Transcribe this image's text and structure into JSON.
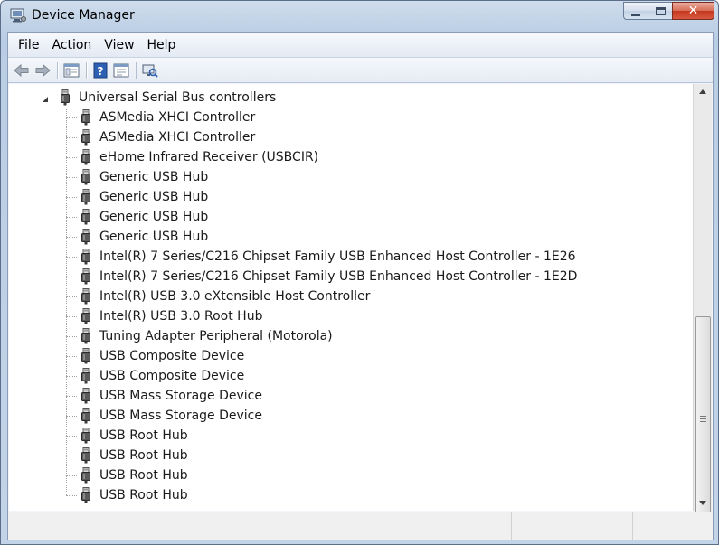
{
  "window": {
    "title": "Device Manager"
  },
  "menu": {
    "items": [
      "File",
      "Action",
      "View",
      "Help"
    ]
  },
  "toolbar": {
    "buttons": [
      "back-icon",
      "forward-icon",
      "tree-view-icon",
      "help-icon",
      "properties-icon",
      "scan-hardware-icon"
    ]
  },
  "tree": {
    "category": {
      "label": "Universal Serial Bus controllers",
      "expanded": true
    },
    "devices": [
      "ASMedia XHCI Controller",
      "ASMedia XHCI Controller",
      "eHome Infrared Receiver (USBCIR)",
      "Generic USB Hub",
      "Generic USB Hub",
      "Generic USB Hub",
      "Generic USB Hub",
      "Intel(R) 7 Series/C216 Chipset Family USB Enhanced Host Controller - 1E26",
      "Intel(R) 7 Series/C216 Chipset Family USB Enhanced Host Controller - 1E2D",
      "Intel(R) USB 3.0 eXtensible Host Controller",
      "Intel(R) USB 3.0 Root Hub",
      "Tuning Adapter Peripheral (Motorola)",
      "USB Composite Device",
      "USB Composite Device",
      "USB Mass Storage Device",
      "USB Mass Storage Device",
      "USB Root Hub",
      "USB Root Hub",
      "USB Root Hub",
      "USB Root Hub"
    ]
  },
  "colors": {
    "title_bar": "#c3d4e8",
    "close_button": "#c4381f",
    "window_border": "#5b6f8a"
  }
}
